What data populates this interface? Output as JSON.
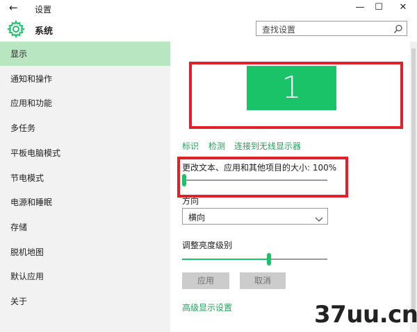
{
  "window": {
    "back_glyph": "←",
    "title": "设置",
    "controls": {
      "minimize": "—",
      "maximize": "☐",
      "close": "✕"
    }
  },
  "header": {
    "icon": "gear-icon",
    "title": "系统",
    "search": {
      "placeholder": "查找设置",
      "icon": "search-icon"
    }
  },
  "sidebar": {
    "selected_index": 0,
    "items": [
      {
        "label": "显示"
      },
      {
        "label": "通知和操作"
      },
      {
        "label": "应用和功能"
      },
      {
        "label": "多任务"
      },
      {
        "label": "平板电脑模式"
      },
      {
        "label": "节电模式"
      },
      {
        "label": "电源和睡眠"
      },
      {
        "label": "存储"
      },
      {
        "label": "脱机地图"
      },
      {
        "label": "默认应用"
      },
      {
        "label": "关于"
      }
    ]
  },
  "display": {
    "monitor_label": "1",
    "links": {
      "identify": "标识",
      "detect": "检测",
      "connect_wireless": "连接到无线显示器"
    },
    "scale": {
      "label": "更改文本、应用和其他项目的大小: 100%",
      "slider_fraction": 0.0
    },
    "orientation": {
      "label": "方向",
      "value": "横向"
    },
    "brightness": {
      "label": "调整亮度级别",
      "slider_fraction": 0.6
    },
    "buttons": {
      "apply": "应用",
      "cancel": "取消"
    },
    "advanced_link": "高级显示设置"
  },
  "watermark": "37uu.cn",
  "colors": {
    "accent": "#1bc368",
    "selection": "#b8e6c1",
    "highlight_box": "#e02127",
    "link": "#21a35a"
  }
}
